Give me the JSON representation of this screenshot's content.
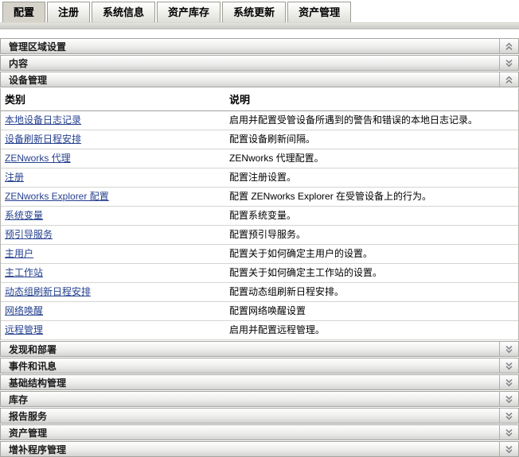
{
  "tabs": [
    {
      "label": "配置",
      "active": true
    },
    {
      "label": "注册",
      "active": false
    },
    {
      "label": "系统信息",
      "active": false
    },
    {
      "label": "资产库存",
      "active": false
    },
    {
      "label": "系统更新",
      "active": false
    },
    {
      "label": "资产管理",
      "active": false
    }
  ],
  "sections": {
    "management_zone_settings": {
      "label": "管理区域设置",
      "icon": "double-chevron-up-icon",
      "state": "expanded"
    },
    "content": {
      "label": "内容",
      "icon": "double-chevron-down-icon",
      "state": "collapsed"
    },
    "device_management": {
      "label": "设备管理",
      "icon": "double-chevron-up-icon",
      "state": "expanded"
    }
  },
  "table": {
    "columns": [
      "类别",
      "说明"
    ],
    "rows": [
      {
        "category": "本地设备日志记录",
        "description": "启用并配置受管设备所遇到的警告和错误的本地日志记录。"
      },
      {
        "category": "设备刷新日程安排",
        "description": "配置设备刷新间隔。"
      },
      {
        "category": "ZENworks 代理",
        "description": "ZENworks 代理配置。"
      },
      {
        "category": "注册",
        "description": "配置注册设置。"
      },
      {
        "category": "ZENworks Explorer 配置",
        "description": "配置 ZENworks Explorer 在受管设备上的行为。"
      },
      {
        "category": "系统变量",
        "description": "配置系统变量。"
      },
      {
        "category": "预引导服务",
        "description": "配置预引导服务。"
      },
      {
        "category": "主用户",
        "description": "配置关于如何确定主用户的设置。"
      },
      {
        "category": "主工作站",
        "description": "配置关于如何确定主工作站的设置。"
      },
      {
        "category": "动态组刷新日程安排",
        "description": "配置动态组刷新日程安排。"
      },
      {
        "category": "网络唤醒",
        "description": "配置网络唤醒设置"
      },
      {
        "category": "远程管理",
        "description": "启用并配置远程管理。"
      }
    ]
  },
  "collapsed_sections": [
    {
      "label": "发现和部署",
      "icon": "double-chevron-down-icon"
    },
    {
      "label": "事件和讯息",
      "icon": "double-chevron-down-icon"
    },
    {
      "label": "基础结构管理",
      "icon": "double-chevron-down-icon"
    },
    {
      "label": "库存",
      "icon": "double-chevron-down-icon"
    },
    {
      "label": "报告服务",
      "icon": "double-chevron-down-icon"
    },
    {
      "label": "资产管理",
      "icon": "double-chevron-down-icon"
    },
    {
      "label": "增补程序管理",
      "icon": "double-chevron-down-icon"
    }
  ],
  "colors": {
    "link": "#26418f",
    "tab_active_bg": "#d6d3ca",
    "section_gradient_bottom": "#d3d3d1",
    "header_text": "#1b1b1b"
  }
}
